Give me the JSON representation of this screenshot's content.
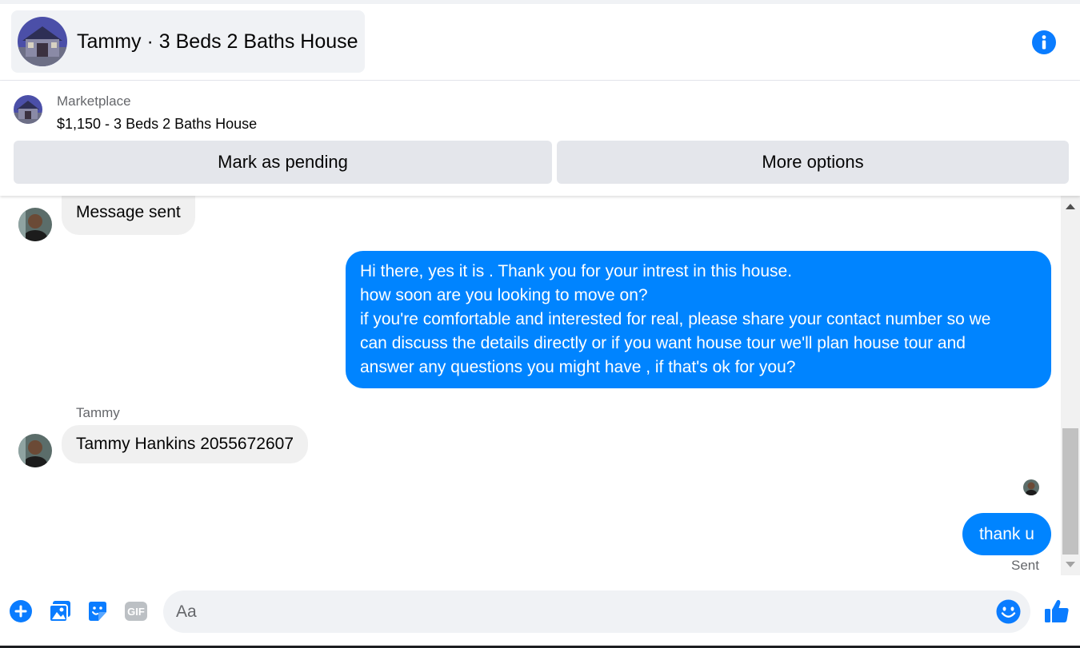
{
  "header": {
    "title": "Tammy · 3 Beds 2 Baths House",
    "info_icon": "info-icon"
  },
  "marketplace": {
    "label": "Marketplace",
    "listing": "$1,150 - 3 Beds 2 Baths House",
    "mark_pending_label": "Mark as pending",
    "more_options_label": "More options"
  },
  "conversation": {
    "message_sent_text": "Message sent",
    "outgoing_long_lines": [
      "Hi there, yes it is . Thank you for your intrest in this house.",
      "how soon are you looking to move on?",
      "if you're comfortable and interested for real, please share your contact number so we",
      "can discuss the details directly or if you  want house tour we'll plan house tour and",
      "answer any questions you might have , if that's ok for you?"
    ],
    "sender_name": "Tammy",
    "incoming_contact": "Tammy Hankins 2055672607",
    "outgoing_short": "thank u",
    "status": "Sent"
  },
  "composer": {
    "placeholder": "Aa",
    "icons": [
      "plus-icon",
      "photo-icon",
      "sticker-icon",
      "gif-icon",
      "emoji-icon",
      "thumbs-up-icon"
    ],
    "gif_label": "GIF"
  },
  "colors": {
    "accent": "#0084ff",
    "icon_blue": "#0a7cff",
    "incoming_bubble": "#f0f0f0",
    "button_gray": "#e4e6eb"
  }
}
